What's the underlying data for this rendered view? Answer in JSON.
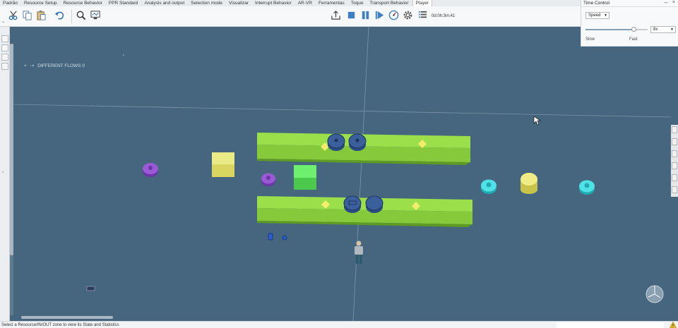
{
  "tabs": [
    {
      "label": "Padrão",
      "active": false
    },
    {
      "label": "Resource Setup",
      "active": false
    },
    {
      "label": "Resource Behavior",
      "active": false
    },
    {
      "label": "PPR Standard",
      "active": false
    },
    {
      "label": "Analysis and output",
      "active": false
    },
    {
      "label": "Selection mode",
      "active": false
    },
    {
      "label": "Visualizar",
      "active": false
    },
    {
      "label": "Interrupt Behavior",
      "active": false
    },
    {
      "label": "AR-VR",
      "active": false
    },
    {
      "label": "Ferramentas",
      "active": false
    },
    {
      "label": "Toque",
      "active": false
    },
    {
      "label": "Transport Behavior",
      "active": false
    },
    {
      "label": "Player",
      "active": true
    }
  ],
  "toolbar": {
    "left_icons": [
      "scissors-icon",
      "copy-icon",
      "paste-icon",
      "undo-icon",
      "zoom-icon",
      "preview-icon"
    ],
    "player_icons": [
      "export-icon",
      "stop-icon",
      "pause-icon",
      "play-icon",
      "speedometer-icon",
      "settings-icon",
      "list-icon"
    ],
    "timer": "0d:0h:3m:41"
  },
  "time_control": {
    "title": "Time Control",
    "mode_select": "Speed",
    "slider_fraction": 0.78,
    "speed_value": "8x",
    "slow_label": "Slow",
    "fast_label": "Fast"
  },
  "tree": {
    "label": "DIFFERENT FLOWS 0",
    "collapse_glyph": "‹"
  },
  "status": {
    "text": "Select a Resource/IN/OUT zone to view its State and Statistics"
  },
  "colors": {
    "scene_background": "#45667e",
    "conveyor": "#8fd63a",
    "source_purple": "#8a4fc4",
    "sink_cyan": "#3ed3d8",
    "part_yellow": "#e6e06a",
    "part_green": "#5ee25e",
    "machine_blue": "#3a5a8c"
  }
}
